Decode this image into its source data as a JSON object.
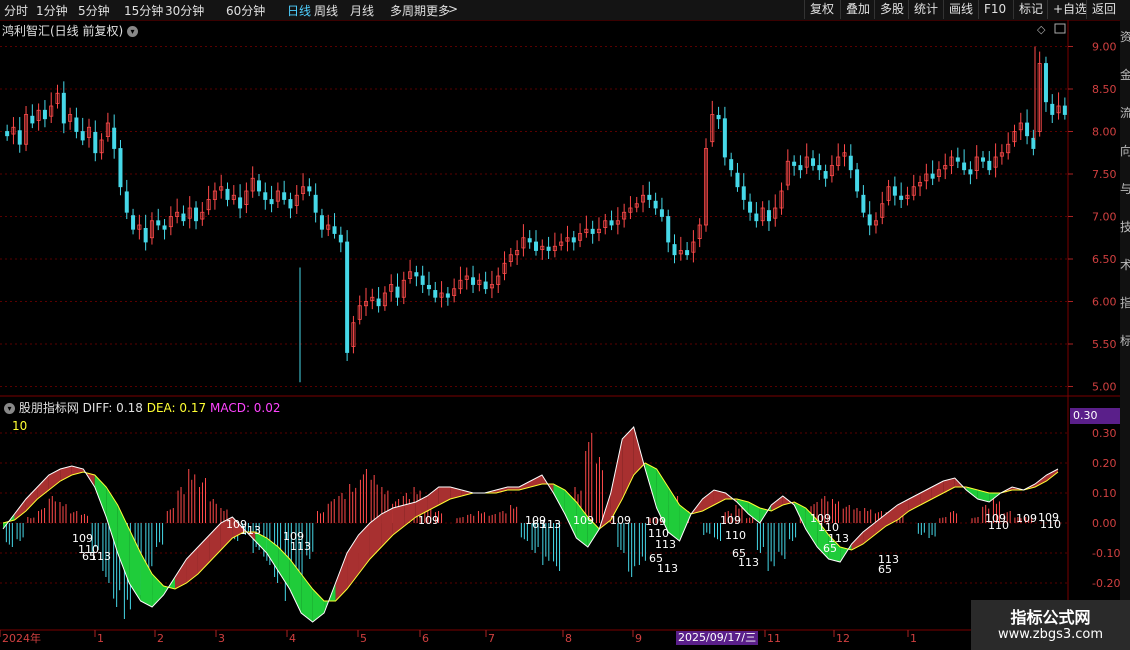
{
  "toolbar": {
    "periods": [
      "分时",
      "1分钟",
      "5分钟",
      "15分钟",
      "30分钟",
      "60分钟",
      "日线",
      "周线",
      "月线",
      "多周期",
      "更多"
    ],
    "active_period": "日线",
    "more_icon": "chevron-right-icon",
    "buttons": [
      "复权",
      "叠加",
      "多股",
      "统计",
      "画线",
      "F10",
      "标记",
      "+自选",
      "返回"
    ]
  },
  "main_panel": {
    "title": "鸿利智汇(日线 前复权)",
    "icon": "chevron-down-icon",
    "price_axis": [
      "9.00",
      "8.50",
      "8.00",
      "7.50",
      "7.00",
      "6.50",
      "6.00",
      "5.50",
      "5.00"
    ]
  },
  "indicator_panel": {
    "name": "股朋指标网",
    "diff_label": "DIFF: 0.18",
    "dea_label": "DEA: 0.17",
    "macd_label": "MACD: 0.02",
    "param": "10",
    "current_value": "0.30",
    "axis": [
      "0.30",
      "0.20",
      "0.10",
      "0.00",
      "-0.10",
      "-0.20"
    ],
    "bar_labels": [
      {
        "text": "109",
        "x": 72,
        "y": 542
      },
      {
        "text": "110",
        "x": 78,
        "y": 553
      },
      {
        "text": "65",
        "x": 82,
        "y": 560
      },
      {
        "text": "113",
        "x": 90,
        "y": 560
      },
      {
        "text": "109",
        "x": 226,
        "y": 528
      },
      {
        "text": "113",
        "x": 240,
        "y": 534
      },
      {
        "text": "109",
        "x": 283,
        "y": 540
      },
      {
        "text": "113",
        "x": 290,
        "y": 550
      },
      {
        "text": "109",
        "x": 418,
        "y": 524
      },
      {
        "text": "109",
        "x": 525,
        "y": 524
      },
      {
        "text": "65",
        "x": 532,
        "y": 528
      },
      {
        "text": "113",
        "x": 540,
        "y": 528
      },
      {
        "text": "109",
        "x": 573,
        "y": 524
      },
      {
        "text": "109",
        "x": 610,
        "y": 524
      },
      {
        "text": "109",
        "x": 645,
        "y": 525
      },
      {
        "text": "110",
        "x": 648,
        "y": 537
      },
      {
        "text": "113",
        "x": 655,
        "y": 548
      },
      {
        "text": "65",
        "x": 649,
        "y": 562
      },
      {
        "text": "113",
        "x": 657,
        "y": 572
      },
      {
        "text": "109",
        "x": 720,
        "y": 524
      },
      {
        "text": "110",
        "x": 725,
        "y": 539
      },
      {
        "text": "65",
        "x": 732,
        "y": 557
      },
      {
        "text": "113",
        "x": 738,
        "y": 566
      },
      {
        "text": "109",
        "x": 810,
        "y": 522
      },
      {
        "text": "110",
        "x": 818,
        "y": 531
      },
      {
        "text": "113",
        "x": 828,
        "y": 542
      },
      {
        "text": "65",
        "x": 823,
        "y": 552
      },
      {
        "text": "113",
        "x": 878,
        "y": 563
      },
      {
        "text": "65",
        "x": 878,
        "y": 573
      },
      {
        "text": "109",
        "x": 985,
        "y": 522
      },
      {
        "text": "110",
        "x": 988,
        "y": 529
      },
      {
        "text": "109",
        "x": 1016,
        "y": 522
      },
      {
        "text": "110",
        "x": 1040,
        "y": 528
      },
      {
        "text": "109",
        "x": 1038,
        "y": 521
      }
    ]
  },
  "time_axis": {
    "labels": [
      "2024年",
      "1",
      "2",
      "3",
      "4",
      "5",
      "6",
      "7",
      "8",
      "9",
      "10",
      "11",
      "12",
      "1"
    ],
    "selected_date": "2025/09/17/三"
  },
  "right_edge_text": [
    "资",
    "金",
    "流",
    "向",
    "与",
    "技",
    "术",
    "指",
    "标"
  ],
  "watermark": {
    "title": "指标公式网",
    "url": "www.zbgs3.com"
  },
  "chart_data": {
    "type": "candlestick",
    "ylim": [
      4.9,
      9.1
    ],
    "up_color": "#ff4a4a",
    "down_color": "#46d8e8",
    "macd_ylim": [
      -0.35,
      0.35
    ],
    "diff_color": "#ffffff",
    "dea_color": "#ffff33",
    "macd_up_color": "#ff4a4a",
    "macd_down_color": "#46d8e8",
    "band_up_color": "#a83030",
    "band_down_color": "#1fcc3a",
    "close_series": [
      7.95,
      8.05,
      7.85,
      8.2,
      8.1,
      8.25,
      8.15,
      8.3,
      8.45,
      8.1,
      8.2,
      8.0,
      7.9,
      8.05,
      7.75,
      7.9,
      8.1,
      7.8,
      7.35,
      7.05,
      6.85,
      6.9,
      6.7,
      6.95,
      6.9,
      6.85,
      7.0,
      7.05,
      6.95,
      7.1,
      6.95,
      7.05,
      7.2,
      7.3,
      7.35,
      7.2,
      7.25,
      7.1,
      7.3,
      7.45,
      7.3,
      7.2,
      7.15,
      7.3,
      7.2,
      7.1,
      7.25,
      7.35,
      7.3,
      7.05,
      6.85,
      6.9,
      6.8,
      6.7,
      5.4,
      5.75,
      5.95,
      6.0,
      6.05,
      5.95,
      6.1,
      6.2,
      6.05,
      6.25,
      6.35,
      6.3,
      6.2,
      6.15,
      6.05,
      6.1,
      6.05,
      6.15,
      6.25,
      6.3,
      6.2,
      6.25,
      6.15,
      6.2,
      6.3,
      6.45,
      6.55,
      6.6,
      6.75,
      6.7,
      6.6,
      6.65,
      6.6,
      6.65,
      6.7,
      6.75,
      6.7,
      6.8,
      6.85,
      6.8,
      6.85,
      6.95,
      6.9,
      6.95,
      7.05,
      7.1,
      7.15,
      7.25,
      7.2,
      7.1,
      7.0,
      6.7,
      6.55,
      6.6,
      6.55,
      6.7,
      6.9,
      7.8,
      8.2,
      8.15,
      7.7,
      7.55,
      7.35,
      7.2,
      7.05,
      6.95,
      7.1,
      6.95,
      7.1,
      7.3,
      7.65,
      7.6,
      7.55,
      7.7,
      7.6,
      7.55,
      7.45,
      7.6,
      7.7,
      7.75,
      7.55,
      7.3,
      7.05,
      6.9,
      6.95,
      7.15,
      7.35,
      7.25,
      7.2,
      7.25,
      7.35,
      7.4,
      7.5,
      7.45,
      7.55,
      7.6,
      7.7,
      7.65,
      7.55,
      7.5,
      7.7,
      7.65,
      7.55,
      7.7,
      7.75,
      7.85,
      8.0,
      8.1,
      7.95,
      7.8,
      8.8,
      8.35,
      8.2,
      8.3,
      8.2
    ],
    "diff_series": [
      -0.02,
      0.03,
      0.08,
      0.12,
      0.16,
      0.18,
      0.19,
      0.18,
      0.12,
      0.02,
      -0.1,
      -0.2,
      -0.26,
      -0.28,
      -0.24,
      -0.18,
      -0.12,
      -0.08,
      -0.04,
      0.0,
      0.02,
      -0.02,
      -0.06,
      -0.1,
      -0.16,
      -0.22,
      -0.3,
      -0.33,
      -0.3,
      -0.2,
      -0.1,
      -0.04,
      0.0,
      0.03,
      0.05,
      0.06,
      0.07,
      0.09,
      0.12,
      0.12,
      0.11,
      0.1,
      0.1,
      0.11,
      0.12,
      0.12,
      0.14,
      0.16,
      0.1,
      0.03,
      -0.05,
      -0.08,
      -0.02,
      0.1,
      0.28,
      0.32,
      0.18,
      0.05,
      -0.03,
      -0.06,
      0.03,
      0.08,
      0.11,
      0.1,
      0.07,
      0.03,
      0.0,
      0.06,
      0.09,
      0.06,
      -0.02,
      -0.08,
      -0.12,
      -0.13,
      -0.07,
      -0.03,
      0.0,
      0.03,
      0.06,
      0.08,
      0.1,
      0.12,
      0.14,
      0.15,
      0.11,
      0.08,
      0.07,
      0.1,
      0.12,
      0.11,
      0.13,
      0.16,
      0.18
    ],
    "dea_series": [
      0.0,
      0.01,
      0.04,
      0.08,
      0.11,
      0.14,
      0.16,
      0.17,
      0.16,
      0.12,
      0.06,
      -0.02,
      -0.1,
      -0.17,
      -0.21,
      -0.22,
      -0.2,
      -0.17,
      -0.13,
      -0.09,
      -0.05,
      -0.03,
      -0.03,
      -0.05,
      -0.08,
      -0.12,
      -0.17,
      -0.22,
      -0.26,
      -0.26,
      -0.22,
      -0.17,
      -0.12,
      -0.08,
      -0.04,
      -0.01,
      0.02,
      0.04,
      0.06,
      0.08,
      0.09,
      0.1,
      0.1,
      0.1,
      0.11,
      0.11,
      0.12,
      0.13,
      0.13,
      0.11,
      0.07,
      0.02,
      -0.02,
      0.01,
      0.08,
      0.16,
      0.2,
      0.18,
      0.12,
      0.06,
      0.03,
      0.04,
      0.06,
      0.08,
      0.08,
      0.07,
      0.05,
      0.04,
      0.06,
      0.07,
      0.05,
      0.01,
      -0.04,
      -0.08,
      -0.09,
      -0.07,
      -0.04,
      -0.01,
      0.01,
      0.04,
      0.06,
      0.08,
      0.1,
      0.12,
      0.12,
      0.11,
      0.1,
      0.1,
      0.11,
      0.11,
      0.12,
      0.14,
      0.17
    ],
    "macd_series": [
      -0.08,
      -0.06,
      0.02,
      0.05,
      0.09,
      0.07,
      0.04,
      0.03,
      -0.1,
      -0.2,
      -0.28,
      -0.32,
      -0.24,
      -0.18,
      -0.08,
      0.05,
      0.12,
      0.18,
      0.15,
      0.08,
      0.05,
      -0.06,
      -0.04,
      -0.1,
      -0.14,
      -0.2,
      -0.26,
      -0.22,
      -0.12,
      0.04,
      0.08,
      0.1,
      0.13,
      0.18,
      0.16,
      0.12,
      0.08,
      0.1,
      0.12,
      0.09,
      0.04,
      0.0,
      0.02,
      0.03,
      0.04,
      0.03,
      0.04,
      0.06,
      -0.06,
      -0.1,
      -0.14,
      -0.16,
      0.0,
      0.12,
      0.3,
      0.22,
      0.06,
      -0.1,
      -0.18,
      -0.14,
      0.02,
      0.06,
      0.1,
      0.04,
      0.0,
      -0.04,
      -0.06,
      0.04,
      0.06,
      0.02,
      -0.1,
      -0.16,
      -0.12,
      -0.06,
      0.04,
      0.07,
      0.09,
      0.08,
      0.06,
      0.05,
      0.05,
      0.04,
      0.04,
      0.05,
      0.0,
      -0.04,
      -0.05,
      0.02,
      0.04,
      0.0,
      0.02,
      0.06,
      0.08,
      0.04,
      0.02,
      0.02
    ]
  }
}
